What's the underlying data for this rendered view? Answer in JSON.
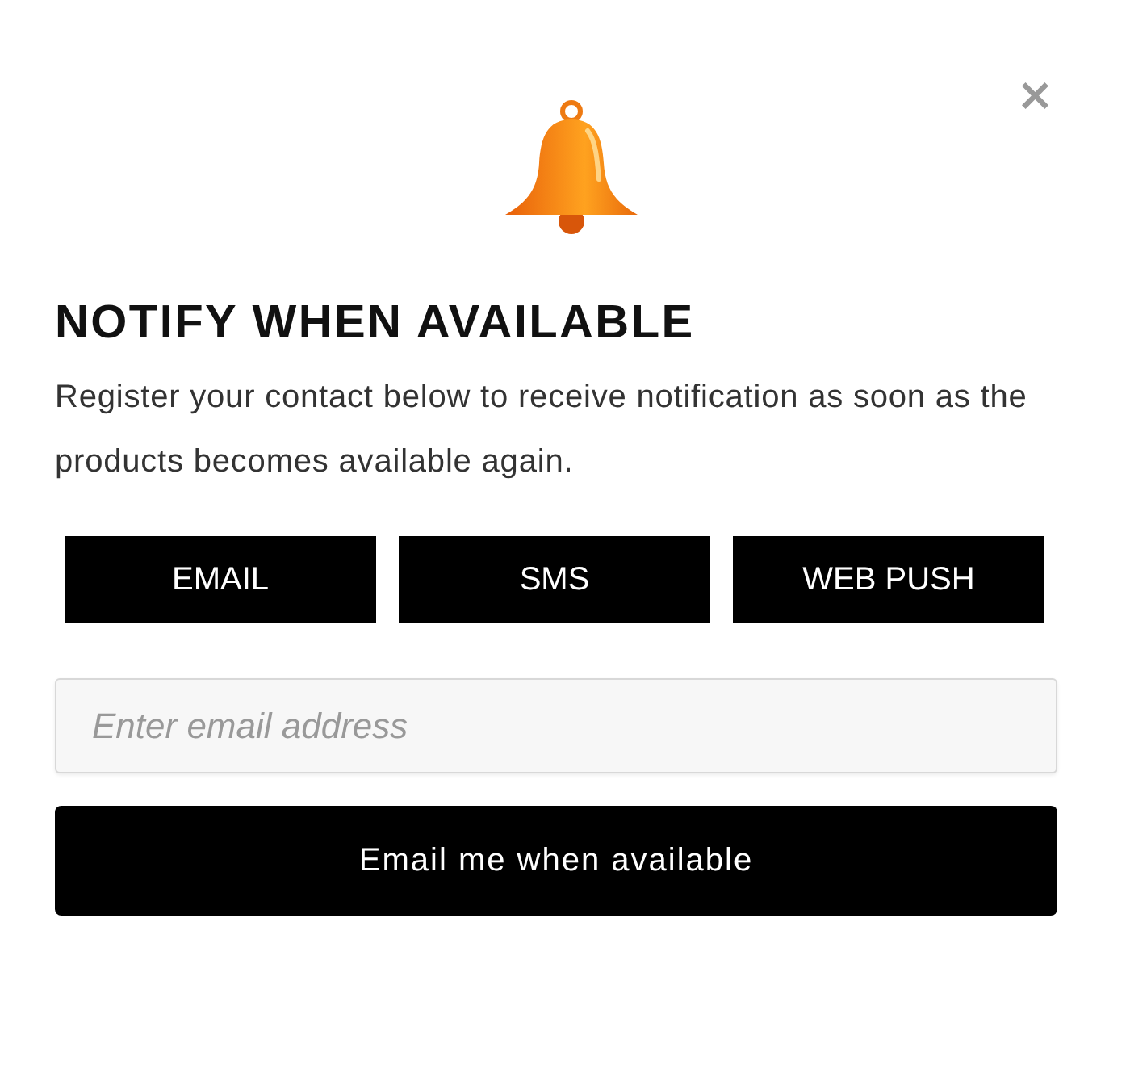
{
  "close_button": "×",
  "title": "NOTIFY WHEN AVAILABLE",
  "description": "Register your contact below to receive notification as soon as the products becomes available again.",
  "tabs": [
    {
      "label": "EMAIL"
    },
    {
      "label": "SMS"
    },
    {
      "label": "WEB PUSH"
    }
  ],
  "email_field": {
    "placeholder": "Enter email address"
  },
  "submit_button": "Email me when available"
}
